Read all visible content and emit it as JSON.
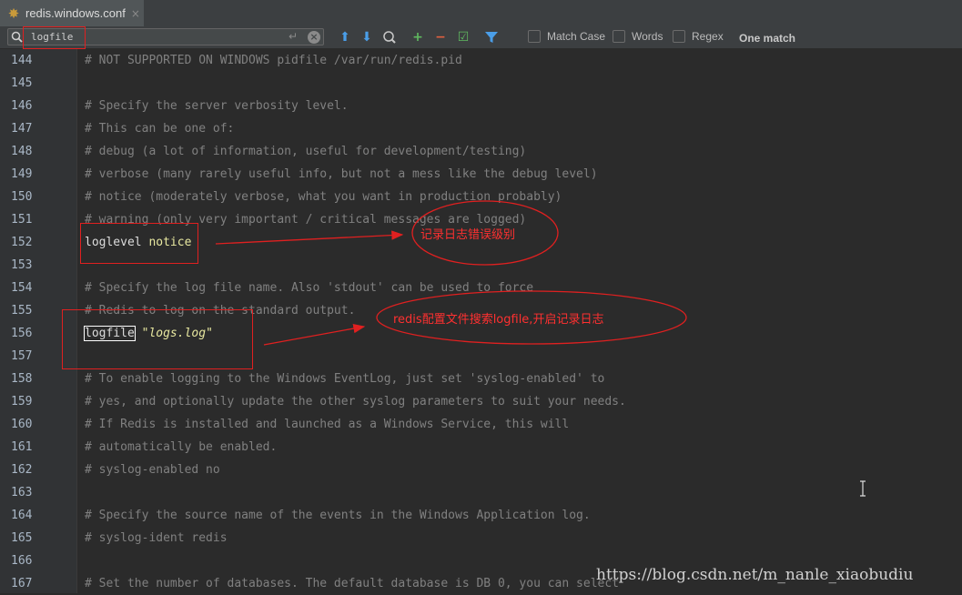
{
  "tab": {
    "title": "redis.windows.conf",
    "close": "×"
  },
  "search": {
    "value": "logfile",
    "options": [
      "Match Case",
      "Words",
      "Regex"
    ],
    "match_count": "One match"
  },
  "editor": {
    "lines": [
      {
        "n": "144",
        "text": "# NOT SUPPORTED ON WINDOWS pidfile /var/run/redis.pid"
      },
      {
        "n": "145",
        "text": ""
      },
      {
        "n": "146",
        "text": "# Specify the server verbosity level."
      },
      {
        "n": "147",
        "text": "# This can be one of:"
      },
      {
        "n": "148",
        "text": "# debug (a lot of information, useful for development/testing)"
      },
      {
        "n": "149",
        "text": "# verbose (many rarely useful info, but not a mess like the debug level)"
      },
      {
        "n": "150",
        "text": "# notice (moderately verbose, what you want in production probably)"
      },
      {
        "n": "151",
        "text": "# warning (only very important / critical messages are logged)"
      },
      {
        "n": "152",
        "key": "loglevel",
        "val": "notice"
      },
      {
        "n": "153",
        "text": ""
      },
      {
        "n": "154",
        "text": "# Specify the log file name. Also 'stdout' can be used to force"
      },
      {
        "n": "155",
        "text": "# Redis to log on the standard output."
      },
      {
        "n": "156",
        "key": "logfile",
        "str": "\"logs.log\""
      },
      {
        "n": "157",
        "text": ""
      },
      {
        "n": "158",
        "text": "# To enable logging to the Windows EventLog, just set 'syslog-enabled' to"
      },
      {
        "n": "159",
        "text": "# yes, and optionally update the other syslog parameters to suit your needs."
      },
      {
        "n": "160",
        "text": "# If Redis is installed and launched as a Windows Service, this will"
      },
      {
        "n": "161",
        "text": "# automatically be enabled."
      },
      {
        "n": "162",
        "text": "# syslog-enabled no"
      },
      {
        "n": "163",
        "text": ""
      },
      {
        "n": "164",
        "text": "# Specify the source name of the events in the Windows Application log."
      },
      {
        "n": "165",
        "text": "# syslog-ident redis"
      },
      {
        "n": "166",
        "text": ""
      },
      {
        "n": "167",
        "text": "# Set the number of databases. The default database is DB 0, you can select"
      }
    ]
  },
  "annotations": {
    "loglevel_note": "记录日志错误级别",
    "logfile_note": "redis配置文件搜索logfile,开启记录日志"
  },
  "watermark": "https://blog.csdn.net/m_nanle_xiaobudiu",
  "colors": {
    "annotation_red": "#e02020",
    "comment": "#808080",
    "value": "#e8e8a0"
  }
}
